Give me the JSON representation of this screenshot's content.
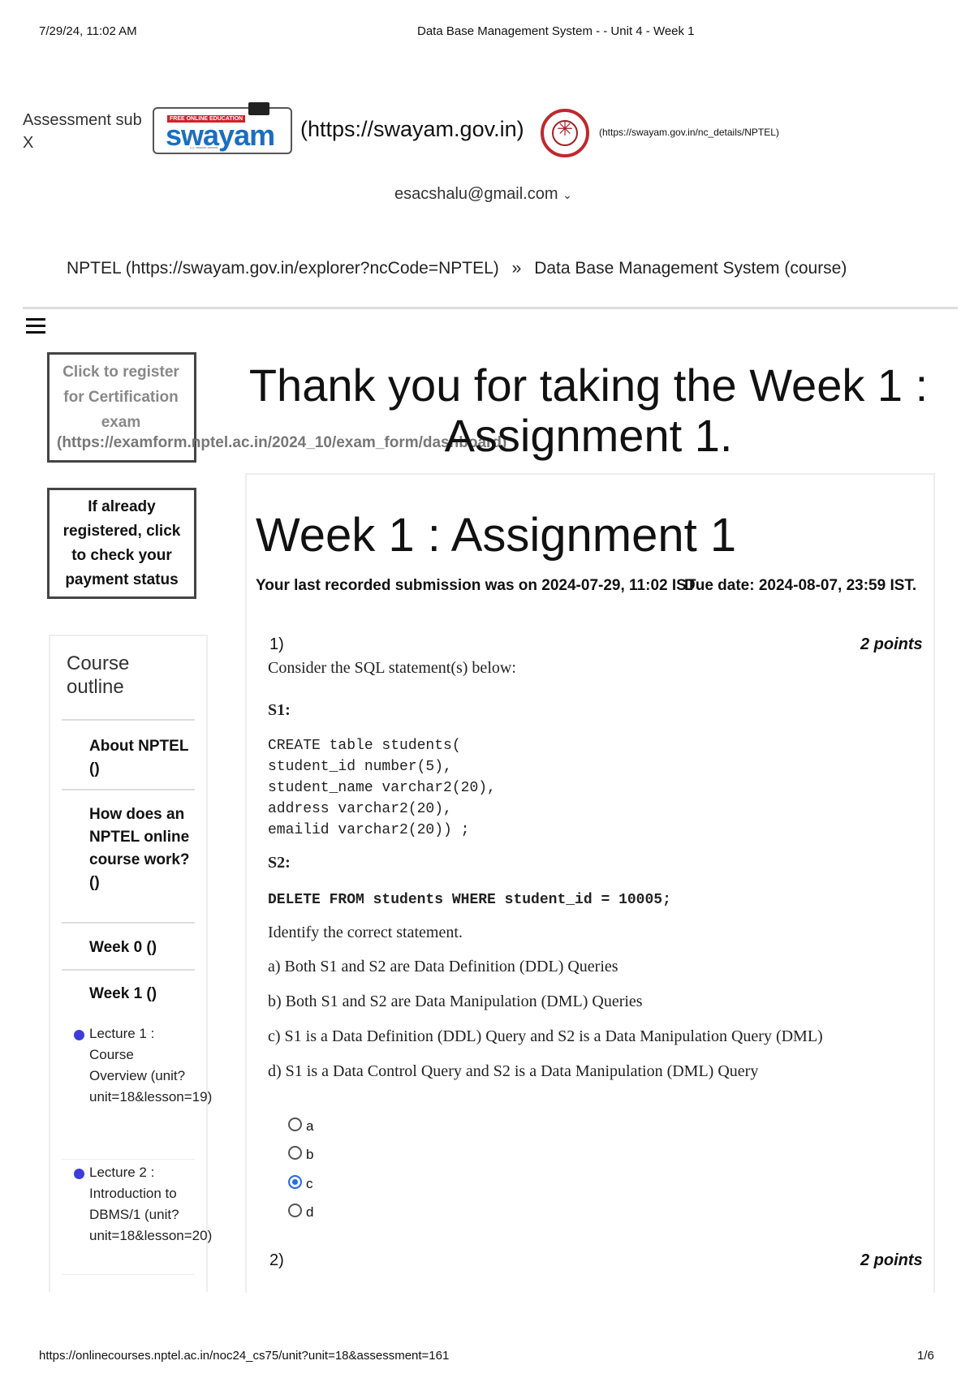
{
  "print_header": {
    "datetime": "7/29/24, 11:02 AM",
    "doc_title": "Data Base Management System - - Unit 4 - Week 1"
  },
  "header": {
    "assessment_label": "Assessment sub X",
    "swayam_logo_text": "swayam",
    "swayam_url": "(https://swayam.gov.in)",
    "nptel_url": "(https://swayam.gov.in/nc_details/NPTEL)",
    "user_email": "esacshalu@gmail.com"
  },
  "breadcrumb": {
    "root": "NPTEL (https://swayam.gov.in/explorer?ncCode=NPTEL)",
    "separator": "»",
    "current": "Data Base Management System (course)"
  },
  "sidebar": {
    "register_label": "Click to register for Certification exam",
    "register_link": "(https://examform.nptel.ac.in/2024_10/exam_form/dashboard)",
    "payment_label": "If already registered, click to check your payment status",
    "outline_title": "Course outline",
    "items": [
      {
        "label": "About NPTEL ()"
      },
      {
        "label": "How does an NPTEL online course work? ()"
      },
      {
        "label": "Week 0 ()"
      },
      {
        "label": "Week 1 ()"
      }
    ],
    "lectures": [
      {
        "label": "Lecture 1 : Course Overview (unit?unit=18&lesson=19)"
      },
      {
        "label": "Lecture 2 : Introduction to DBMS/1 (unit?unit=18&lesson=20)"
      }
    ]
  },
  "main": {
    "thanks": "Thank you for taking the Week 1 : Assignment 1.",
    "title": "Week 1 : Assignment 1",
    "submission": "Your last recorded submission was on 2024-07-29, 11:02 IST",
    "due": "Due date: 2024-08-07, 23:59 IST.",
    "q1": {
      "number": "1)",
      "points": "2 points",
      "intro": "Consider the SQL statement(s) below:",
      "s1_label": "S1:",
      "s1_code": "CREATE table students(\nstudent_id number(5),\nstudent_name varchar2(20),\naddress varchar2(20),\nemailid varchar2(20)) ;",
      "s2_label": "S2:",
      "s2_code": "DELETE FROM students WHERE student_id = 10005;",
      "prompt": "Identify the correct statement.",
      "options": [
        "a) Both S1 and S2 are Data Definition (DDL) Queries",
        "b) Both S1 and S2 are Data Manipulation (DML) Queries",
        "c) S1 is a Data Definition (DDL) Query and S2 is a Data Manipulation Query (DML)",
        "d) S1 is a Data Control Query and S2 is a Data Manipulation (DML) Query"
      ],
      "choices": [
        "a",
        "b",
        "c",
        "d"
      ],
      "selected": "c"
    },
    "q2": {
      "number": "2)",
      "points": "2 points"
    }
  },
  "print_footer": {
    "url": "https://onlinecourses.nptel.ac.in/noc24_cs75/unit?unit=18&assessment=161",
    "page": "1/6"
  }
}
